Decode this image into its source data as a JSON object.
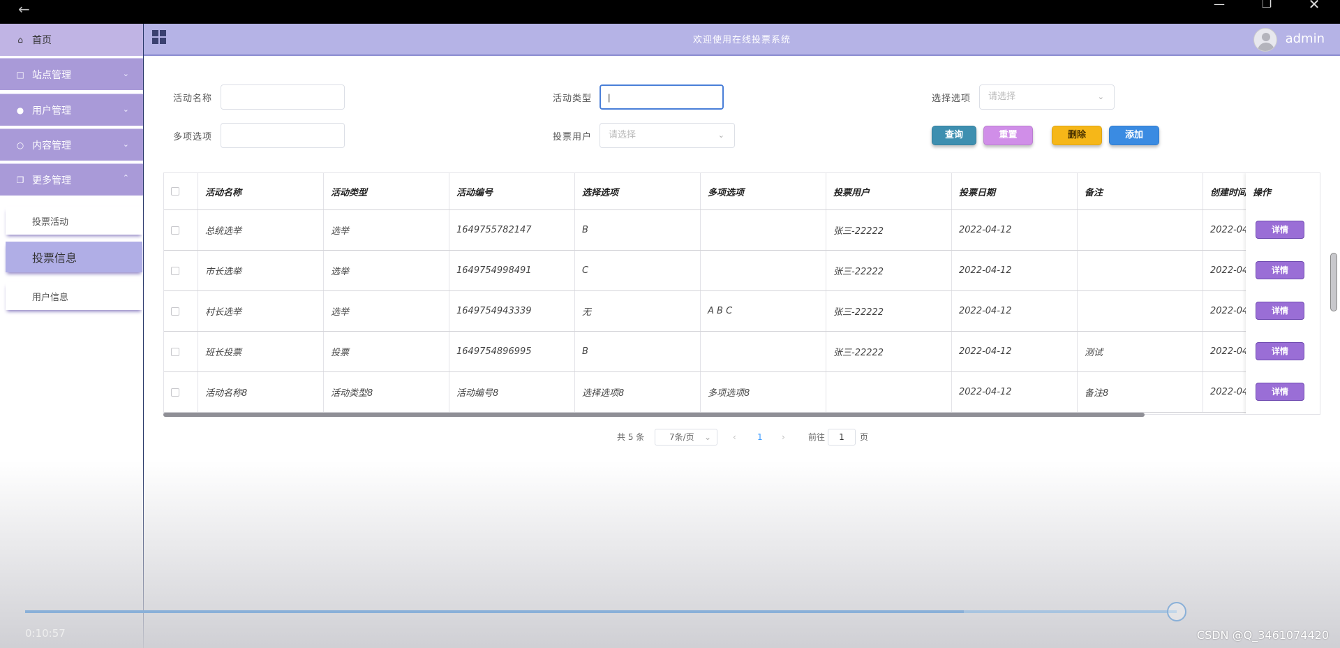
{
  "app": {
    "title": "欢迎使用在线投票系统",
    "user": "admin"
  },
  "sidebar": {
    "home": "首页",
    "menus": [
      {
        "label": "站点管理",
        "icon": "monitor-icon"
      },
      {
        "label": "用户管理",
        "icon": "user-icon"
      },
      {
        "label": "内容管理",
        "icon": "chat-icon"
      },
      {
        "label": "更多管理",
        "icon": "copy-icon"
      }
    ],
    "sub_items": [
      "投票活动",
      "投票信息",
      "用户信息"
    ]
  },
  "filters": {
    "activity_name": {
      "label": "活动名称",
      "value": ""
    },
    "activity_type": {
      "label": "活动类型",
      "value": "|"
    },
    "choice_option": {
      "label": "选择选项",
      "placeholder": "请选择"
    },
    "multi_option": {
      "label": "多项选项",
      "value": ""
    },
    "vote_user": {
      "label": "投票用户",
      "placeholder": "请选择"
    }
  },
  "actions": {
    "query": "查询",
    "reset": "重置",
    "delete": "删除",
    "add": "添加"
  },
  "colors": {
    "query": "#3e8fb0",
    "reset": "#d08ee8",
    "delete": "#f6b718",
    "add": "#3a8be2",
    "detail": "#9a6ed6"
  },
  "table": {
    "headers": [
      "活动名称",
      "活动类型",
      "活动编号",
      "选择选项",
      "多项选项",
      "投票用户",
      "投票日期",
      "备注",
      "创建时间",
      "操作"
    ],
    "rows": [
      [
        "总统选举",
        "选举",
        "1649755782147",
        "B",
        "",
        "张三-22222",
        "2022-04-12",
        "",
        "2022-04-"
      ],
      [
        "市长选举",
        "选举",
        "1649754998491",
        "C",
        "",
        "张三-22222",
        "2022-04-12",
        "",
        "2022-04-"
      ],
      [
        "村长选举",
        "选举",
        "1649754943339",
        "无",
        "A B C",
        "张三-22222",
        "2022-04-12",
        "",
        "2022-04-"
      ],
      [
        "班长投票",
        "投票",
        "1649754896995",
        "B",
        "",
        "张三-22222",
        "2022-04-12",
        "测试",
        "2022-04-"
      ],
      [
        "活动名称8",
        "活动类型8",
        "活动编号8",
        "选择选项8",
        "多项选项8",
        "",
        "2022-04-12",
        "备注8",
        "2022-04-"
      ]
    ],
    "detail_label": "详情"
  },
  "pagination": {
    "total": "共 5 条",
    "page_size": "7条/页",
    "current": "1",
    "goto": "前往",
    "page_unit": "页",
    "jump_value": "1"
  },
  "video": {
    "time": "0:10:57",
    "progress": 0.815
  },
  "watermark": "CSDN @Q_3461074420"
}
